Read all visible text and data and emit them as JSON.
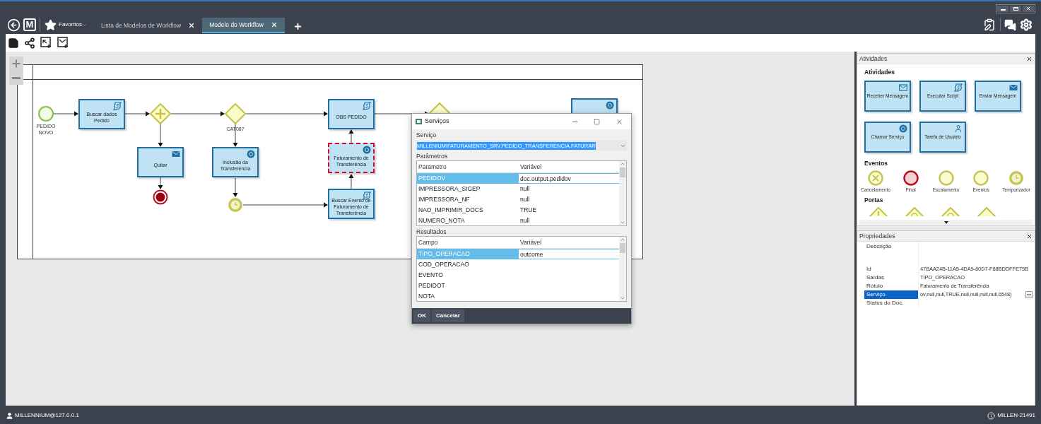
{
  "top_bar": {
    "logo": "M",
    "favorites": "Favoritos"
  },
  "tabs": [
    {
      "label": "Lista de Modelos de Workflow",
      "selected": false
    },
    {
      "label": "Modelo do Workflow",
      "selected": true
    }
  ],
  "diagram": {
    "nodes": [
      {
        "kind": "start",
        "label": "PEDIDO NOVO"
      },
      {
        "kind": "script-task",
        "label": "Buscar dados Pedido",
        "selected": false
      },
      {
        "kind": "parallel-gateway"
      },
      {
        "kind": "message-task",
        "label": "Quitar",
        "selected": false
      },
      {
        "kind": "end"
      },
      {
        "kind": "gateway",
        "label": "CAT087"
      },
      {
        "kind": "service-task",
        "label": "Inclusão da Transferencia",
        "selected": false
      },
      {
        "kind": "timer"
      },
      {
        "kind": "script-task",
        "label": "OBS PEDIDO",
        "selected": false
      },
      {
        "kind": "service-task",
        "label": "Faturamento de Transferência",
        "selected": true
      },
      {
        "kind": "script-task",
        "label": "Buscar Evento de Faturamento de Transferência",
        "selected": false
      },
      {
        "kind": "gateway"
      },
      {
        "kind": "service-task",
        "selected": false
      }
    ]
  },
  "dialog": {
    "title": "Serviços",
    "service_label": "Serviço",
    "service_value": "MILLENIUM!FATURAMENTO_SRV.PEDIDO_TRANSFERENCIA.FATURAR",
    "params_label": "Parâmetros",
    "params_columns": [
      "Parametro",
      "Variável"
    ],
    "params": [
      {
        "name": "PEDIDOV",
        "value": "doc.output.pedidov",
        "selected": true
      },
      {
        "name": "IMPRESSORA_SIGEP",
        "value": "null",
        "selected": false
      },
      {
        "name": "IMPRESSORA_NF",
        "value": "null",
        "selected": false
      },
      {
        "name": "NAO_IMPRIMIR_DOCS",
        "value": "TRUE",
        "selected": false
      },
      {
        "name": "NUMERO_NOTA",
        "value": "null",
        "selected": false
      }
    ],
    "results_label": "Resultados",
    "results_columns": [
      "Campo",
      "Variável"
    ],
    "results": [
      {
        "name": "TIPO_OPERACAO",
        "value": "outcome",
        "selected": true
      },
      {
        "name": "COD_OPERACAO",
        "selected": false
      },
      {
        "name": "EVENTO",
        "selected": false
      },
      {
        "name": "PEDIDOT",
        "selected": false
      },
      {
        "name": "NOTA",
        "selected": false
      }
    ],
    "buttons": [
      "OK",
      "Cancelar"
    ]
  },
  "activities_panel": {
    "title": "Atividades",
    "activities_title": "Atividades",
    "activities": [
      {
        "label": "Receber Mensagem",
        "kind": "receive"
      },
      {
        "label": "Executar Script",
        "kind": "script"
      },
      {
        "label": "Enviar Mensagem",
        "kind": "send"
      },
      {
        "label": "Chamar Serviço",
        "kind": "service"
      },
      {
        "label": "Tarefa de Usuário",
        "kind": "user"
      }
    ],
    "events_title": "Eventos",
    "events": [
      {
        "label": "Cancelamento",
        "kind": "cancel"
      },
      {
        "label": "Final",
        "kind": "end"
      },
      {
        "label": "Escalamento",
        "kind": "plain"
      },
      {
        "label": "Eventos",
        "kind": "plain"
      },
      {
        "label": "Temporizador",
        "kind": "timer"
      }
    ],
    "gateways_title": "Portas",
    "gateways": [
      {
        "kind": "exclusive"
      },
      {
        "kind": "complex"
      },
      {
        "kind": "complex"
      },
      {
        "kind": "plain"
      }
    ]
  },
  "properties_panel": {
    "title": "Propriedades",
    "rows": [
      {
        "name": "Descrição",
        "selected": false
      },
      {
        "name": "Id",
        "value": "47BAA24B-11A5-4DA9-80D7-F88BDDFFE75B",
        "selected": false
      },
      {
        "name": "Saídas",
        "value": "TIPO_OPERACAO",
        "selected": false
      },
      {
        "name": "Rótulo",
        "value": "Faturamento de Transferência",
        "selected": false
      },
      {
        "name": "Serviço",
        "value": "ov,null,null,TRUE,null,null,null,null,6548)",
        "selected": true
      },
      {
        "name": "Status do Doc.",
        "selected": false
      }
    ]
  },
  "status_bar": {
    "user": "MILLENNIUM@127.0.0.1",
    "machine": "MILLEN-21491"
  }
}
